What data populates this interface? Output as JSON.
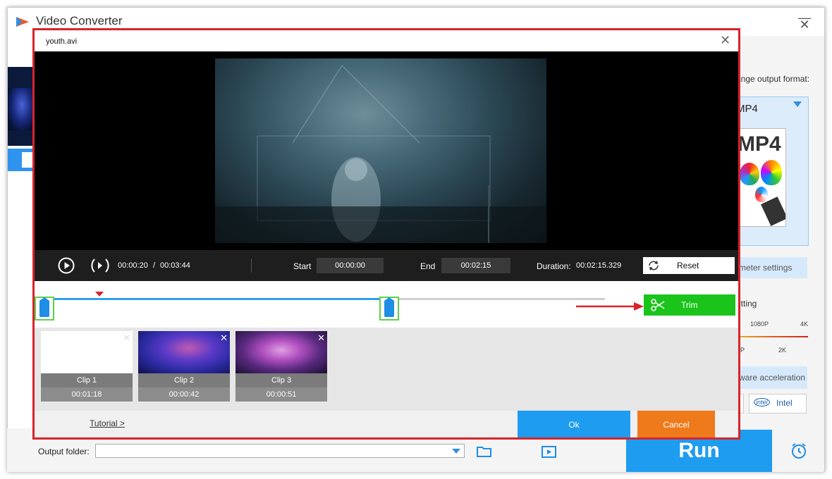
{
  "app": {
    "title": "Video Converter"
  },
  "right_panel": {
    "output_format_label": "ange output format:",
    "format_name": "MP4",
    "format_art_text": "MP4",
    "parameter_settings": "meter settings",
    "quality_setting_label": "etting",
    "resolution_ticks_top": [
      "1080P",
      "4K"
    ],
    "resolution_ticks_bottom": [
      "20P",
      "2K"
    ],
    "hardware_acceleration": "ware acceleration",
    "gpu_intel_logo": "intel",
    "gpu_intel_label": "Intel"
  },
  "bottom_bar": {
    "output_folder_label": "Output folder:",
    "output_folder_value": "",
    "run_label": "Run"
  },
  "dialog": {
    "title": "youth.avi",
    "current_time": "00:00:20",
    "time_separator": "/",
    "total_time": "00:03:44",
    "start_label": "Start",
    "start_value": "00:00:00",
    "end_label": "End",
    "end_value": "00:02:15",
    "duration_label": "Duration:",
    "duration_value": "00:02:15.329",
    "reset_label": "Reset",
    "trim_label": "Trim",
    "clips": [
      {
        "name": "Clip 1",
        "duration": "00:01:18"
      },
      {
        "name": "Clip 2",
        "duration": "00:00:42"
      },
      {
        "name": "Clip 3",
        "duration": "00:00:51"
      }
    ],
    "tutorial_label": "Tutorial >",
    "ok_label": "Ok",
    "cancel_label": "Cancel"
  },
  "colors": {
    "accent_blue": "#1e9cf0",
    "trim_green": "#1ac41a",
    "cancel_orange": "#ef7a1c",
    "highlight_red": "#d8232a"
  },
  "icons": [
    "app-logo-icon",
    "minimize-icon",
    "close-icon",
    "play-icon",
    "next-frame-icon",
    "reset-icon",
    "scissors-icon",
    "folder-icon",
    "media-folder-icon",
    "alarm-clock-icon",
    "dropdown-arrow-icon"
  ]
}
